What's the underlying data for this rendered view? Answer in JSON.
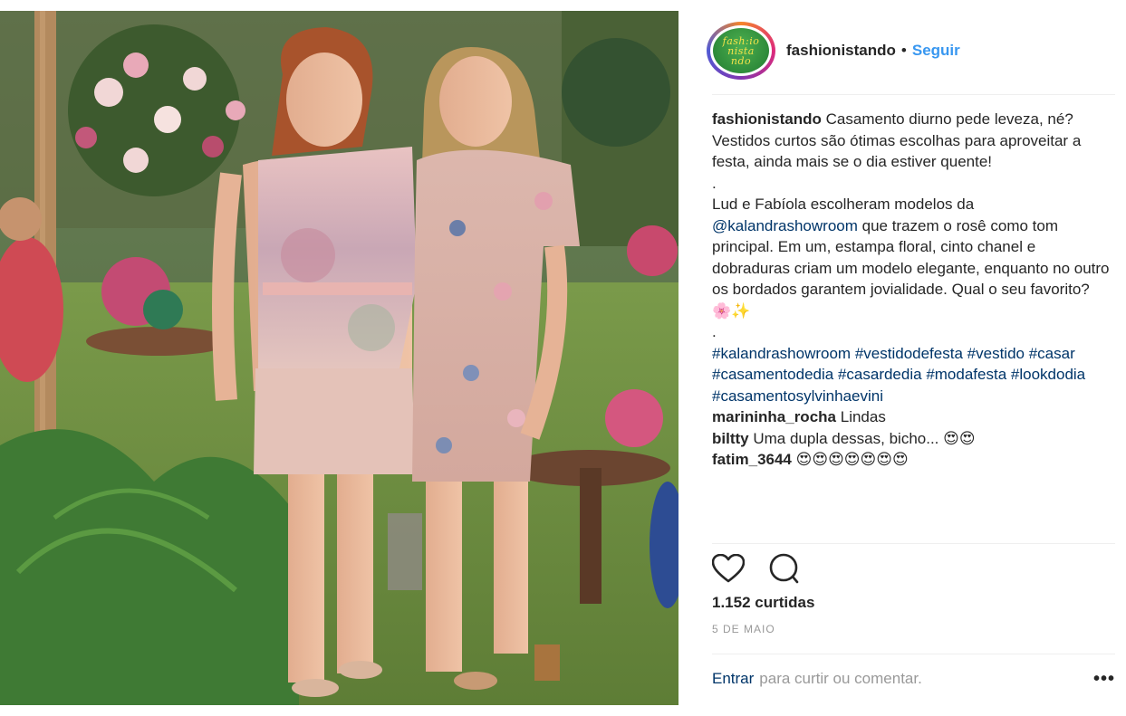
{
  "header": {
    "avatar_text": [
      "fash:io",
      "nista",
      "ndo"
    ],
    "username": "fashionistando",
    "separator": "•",
    "follow_label": "Seguir"
  },
  "caption": {
    "username": "fashionistando",
    "text_1": "Casamento diurno pede leveza, né? Vestidos curtos são ótimas escolhas para aproveitar a festa, ainda mais se o dia estiver quente!",
    "sep_1": ".",
    "text_2_before": "Lud e Fabíola escolheram modelos da",
    "mention": "@kalandrashowroom",
    "text_2_after": "que trazem o rosê como tom principal. Em um, estampa floral, cinto chanel e dobraduras criam um modelo elegante, enquanto no outro os bordados garantem jovialidade. Qual o seu favorito? 🌸✨",
    "sep_2": ".",
    "hashtags": [
      "#kalandrashowroom",
      "#vestidodefesta",
      "#vestido",
      "#casar",
      "#casamentodedia",
      "#casardedia",
      "#modafesta",
      "#lookdodia",
      "#casamentosylvinhaevini"
    ]
  },
  "comments": [
    {
      "username": "marininha_rocha",
      "text": "Lindas"
    },
    {
      "username": "biltty",
      "text": "Uma dupla dessas, bicho... 😍😍"
    },
    {
      "username": "fatim_3644",
      "text": "😍😍😍😍😍😍😍"
    }
  ],
  "actions": {
    "like_icon": "heart-icon",
    "comment_icon": "comment-icon"
  },
  "likes_text": "1.152 curtidas",
  "date_text": "5 DE MAIO",
  "footer": {
    "login_label": "Entrar",
    "prompt": "para curtir ou comentar.",
    "more_label": "•••"
  },
  "colors": {
    "link": "#003569",
    "follow": "#3897f0",
    "muted": "#999999",
    "text": "#262626"
  }
}
